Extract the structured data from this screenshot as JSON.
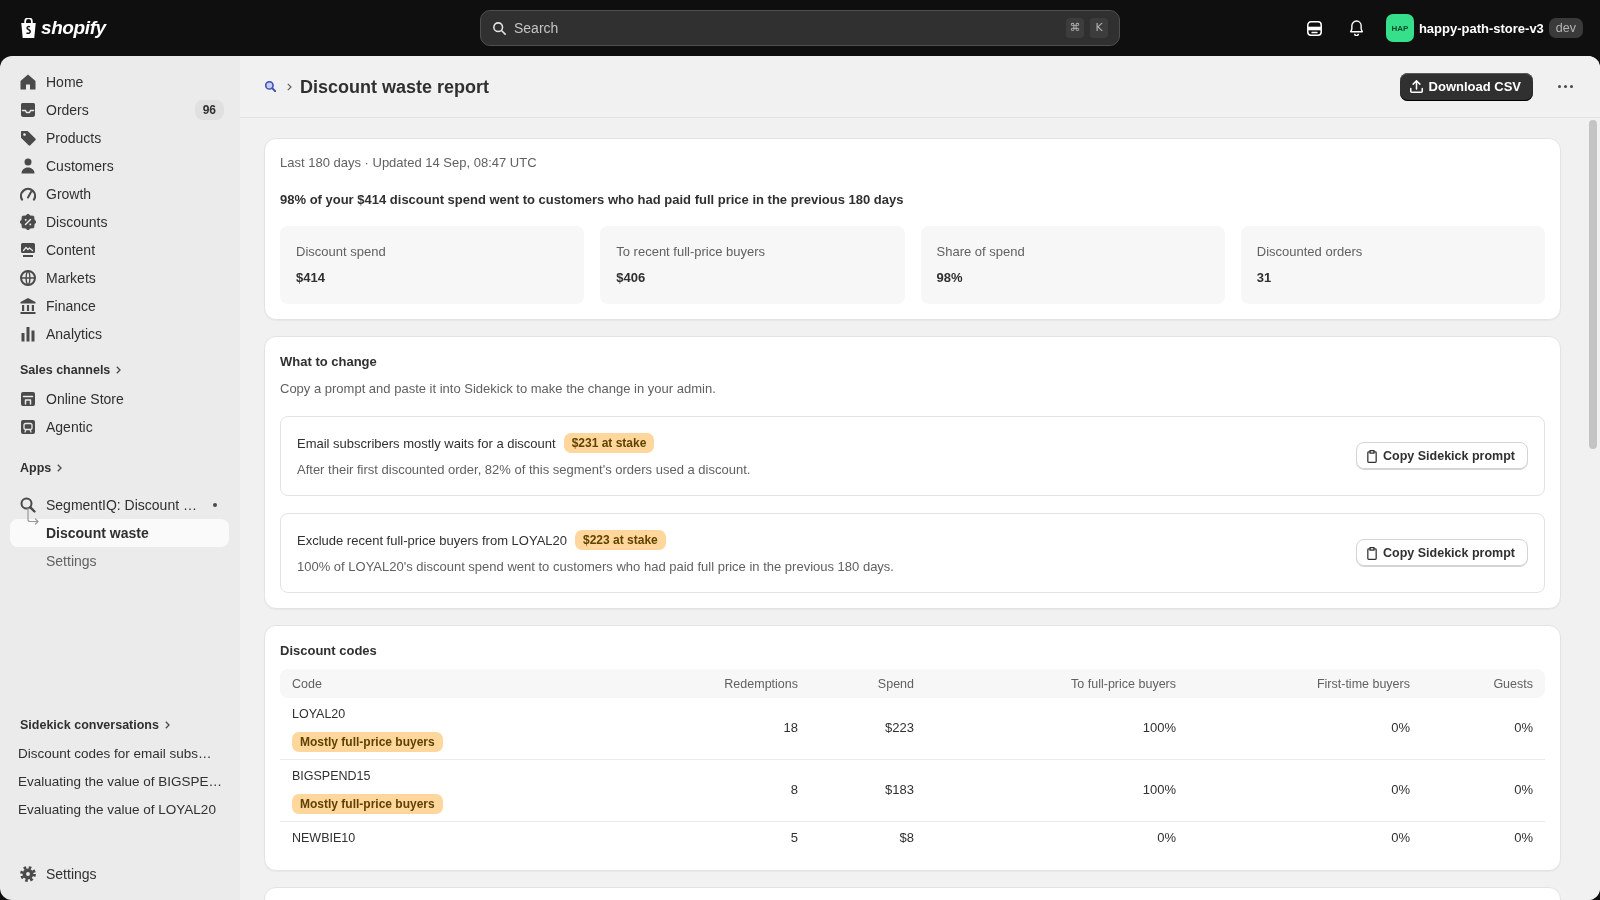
{
  "topbar": {
    "logo_text": "shopify",
    "search": {
      "placeholder": "Search",
      "shortcut": [
        "⌘",
        "K"
      ]
    },
    "store": {
      "avatar": "HAP",
      "name": "happy-path-store-v3",
      "badge": "dev"
    }
  },
  "sidebar": {
    "items": [
      {
        "label": "Home",
        "selected": false
      },
      {
        "label": "Orders",
        "badge": "96",
        "selected": false
      },
      {
        "label": "Products",
        "selected": false
      },
      {
        "label": "Customers",
        "selected": false
      },
      {
        "label": "Growth",
        "selected": false
      },
      {
        "label": "Discounts",
        "selected": false
      },
      {
        "label": "Content",
        "selected": false
      },
      {
        "label": "Markets",
        "selected": false
      },
      {
        "label": "Finance",
        "selected": false
      },
      {
        "label": "Analytics",
        "selected": false
      }
    ],
    "sections": [
      {
        "heading": "Sales channels",
        "items": [
          {
            "label": "Online Store",
            "selected": false
          },
          {
            "label": "Agentic",
            "selected": false
          }
        ]
      },
      {
        "heading": "Apps",
        "items": [
          {
            "label": "SegmentIQ: Discount …",
            "selected": false,
            "expanded": true,
            "children": [
              {
                "label": "Discount waste",
                "selected": true
              },
              {
                "label": "Settings",
                "selected": false
              }
            ]
          }
        ]
      }
    ],
    "conversations": {
      "heading": "Sidekick conversations",
      "items": [
        {
          "label": "Discount codes for email subs…",
          "selected": false
        },
        {
          "label": "Evaluating the value of BIGSPE…",
          "selected": false
        },
        {
          "label": "Evaluating the value of LOYAL20",
          "selected": false
        }
      ]
    },
    "footer": {
      "label": "Settings",
      "selected": false
    }
  },
  "page_header": {
    "title": "Discount waste report",
    "primary_action": "Download CSV"
  },
  "summary": {
    "meta": "Last 180 days · Updated 14 Sep, 08:47 UTC",
    "headline": "98% of your $414 discount spend went to customers who had paid full price in the previous 180 days",
    "stats": [
      {
        "label": "Discount spend",
        "value": "$414"
      },
      {
        "label": "To recent full-price buyers",
        "value": "$406"
      },
      {
        "label": "Share of spend",
        "value": "98%"
      },
      {
        "label": "Discounted orders",
        "value": "31"
      }
    ]
  },
  "what_to_change": {
    "title": "What to change",
    "description": "Copy a prompt and paste it into Sidekick to make the change in your admin.",
    "recommendations": [
      {
        "title": "Email subscribers mostly waits for a discount",
        "badge": "$231 at stake",
        "detail": "After their first discounted order, 82% of this segment's orders used a discount.",
        "action": "Copy Sidekick prompt"
      },
      {
        "title": "Exclude recent full-price buyers from LOYAL20",
        "badge": "$223 at stake",
        "detail": "100% of LOYAL20's discount spend went to customers who had paid full price in the previous 180 days.",
        "action": "Copy Sidekick prompt"
      }
    ]
  },
  "discount_codes": {
    "title": "Discount codes",
    "columns": [
      "Code",
      "Redemptions",
      "Spend",
      "To full-price buyers",
      "First-time buyers",
      "Guests"
    ],
    "rows": [
      {
        "cells": [
          "LOYAL20",
          "18",
          "$223",
          "100%",
          "0%",
          "0%"
        ],
        "tag": "Mostly full-price buyers"
      },
      {
        "cells": [
          "BIGSPEND15",
          "8",
          "$183",
          "100%",
          "0%",
          "0%"
        ],
        "tag": "Mostly full-price buyers"
      },
      {
        "cells": [
          "NEWBIE10",
          "5",
          "$8",
          "0%",
          "0%",
          "0%"
        ]
      }
    ]
  }
}
